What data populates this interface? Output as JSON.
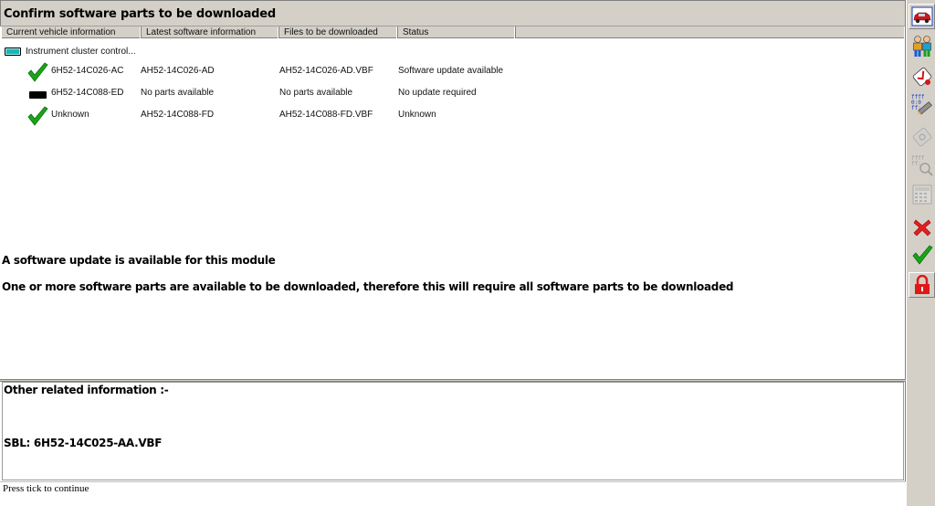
{
  "window": {
    "title": "Confirm software parts to be downloaded"
  },
  "columns": [
    "Current vehicle information",
    "Latest software information",
    "Files to be downloaded",
    "Status"
  ],
  "tree": {
    "root_label": "Instrument cluster control...",
    "rows": [
      {
        "icon": "green-check-icon",
        "current": "6H52-14C026-AC",
        "latest": "AH52-14C026-AD",
        "files": "AH52-14C026-AD.VBF",
        "status": "Software update available"
      },
      {
        "icon": "black-bar-icon",
        "current": "6H52-14C088-ED",
        "latest": "No parts available",
        "files": "No parts available",
        "status": "No update required"
      },
      {
        "icon": "green-check-icon",
        "current": "Unknown",
        "latest": "AH52-14C088-FD",
        "files": "AH52-14C088-FD.VBF",
        "status": "Unknown"
      }
    ]
  },
  "messages": {
    "line1": "A software update is available for this module",
    "line2": "One or more software parts are available to be downloaded, therefore this will require all software parts to be downloaded"
  },
  "related": {
    "heading": "Other related information :-",
    "sbl": "SBL: 6H52-14C025-AA.VBF"
  },
  "status_bar": {
    "text": "Press tick to continue"
  },
  "toolbar": {
    "buttons": [
      "vehicle-icon",
      "people-icon",
      "diagnostic-tag-icon",
      "data-pen-icon",
      "tag-disabled-icon",
      "data-search-disabled-icon",
      "calculator-disabled-icon",
      "cancel-x-icon",
      "tick-icon",
      "padlock-icon"
    ]
  },
  "colors": {
    "panel": "#d4d0c8",
    "check_green": "#19a519",
    "cancel_red": "#e02020",
    "lock_red": "#e01818",
    "module_teal": "#17b6b8"
  }
}
